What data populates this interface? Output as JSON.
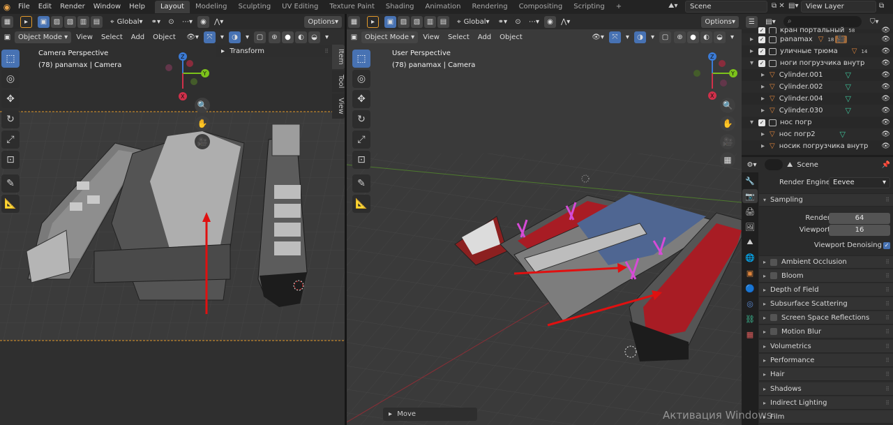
{
  "menu": [
    "File",
    "Edit",
    "Render",
    "Window",
    "Help"
  ],
  "workspaces": [
    "Layout",
    "Modeling",
    "Sculpting",
    "UV Editing",
    "Texture Paint",
    "Shading",
    "Animation",
    "Rendering",
    "Compositing",
    "Scripting"
  ],
  "active_workspace": "Layout",
  "add_workspace": "+",
  "scene": "Scene",
  "view_layer": "View Layer",
  "viewport_header": {
    "mode": "Object Mode",
    "menus": [
      "View",
      "Select",
      "Add",
      "Object"
    ],
    "orientation": "Global",
    "options": "Options"
  },
  "left_viewport": {
    "title": "Camera Perspective",
    "subtitle": "(78) panamax | Camera",
    "panel": "Transform",
    "side_tabs": [
      "Item",
      "Tool",
      "View"
    ]
  },
  "right_viewport": {
    "title": "User Perspective",
    "subtitle": "(78) panamax | Camera",
    "operator_panel": "Move"
  },
  "outliner": {
    "rows": [
      {
        "label": "кран портальный",
        "kind": "collection",
        "badge": "58"
      },
      {
        "label": "panamax",
        "kind": "collection",
        "badge": "18"
      },
      {
        "label": "уличные трюма",
        "kind": "collection",
        "badge": "14"
      },
      {
        "label": "ноги погрузчика внутр",
        "kind": "collection",
        "badge": ""
      },
      {
        "label": "Cylinder.001",
        "kind": "object",
        "badge": ""
      },
      {
        "label": "Cylinder.002",
        "kind": "object",
        "badge": ""
      },
      {
        "label": "Cylinder.004",
        "kind": "object",
        "badge": ""
      },
      {
        "label": "Cylinder.030",
        "kind": "object",
        "badge": ""
      },
      {
        "label": "нос погр",
        "kind": "collection",
        "badge": ""
      },
      {
        "label": "нос погр2",
        "kind": "object",
        "badge": ""
      },
      {
        "label": "носик погрузчика внутр",
        "kind": "object",
        "badge": ""
      }
    ]
  },
  "properties": {
    "context": "Scene",
    "render_engine_label": "Render Engine",
    "render_engine": "Eevee",
    "sampling": {
      "title": "Sampling",
      "render_label": "Render",
      "render": "64",
      "viewport_label": "Viewport",
      "viewport": "16",
      "denoise_label": "Viewport Denoising"
    },
    "panels": [
      {
        "label": "Ambient Occlusion",
        "checkbox": true
      },
      {
        "label": "Bloom",
        "checkbox": true
      },
      {
        "label": "Depth of Field",
        "checkbox": false
      },
      {
        "label": "Subsurface Scattering",
        "checkbox": false
      },
      {
        "label": "Screen Space Reflections",
        "checkbox": true
      },
      {
        "label": "Motion Blur",
        "checkbox": true
      },
      {
        "label": "Volumetrics",
        "checkbox": false
      },
      {
        "label": "Performance",
        "checkbox": false
      },
      {
        "label": "Hair",
        "checkbox": false
      },
      {
        "label": "Shadows",
        "checkbox": false
      },
      {
        "label": "Indirect Lighting",
        "checkbox": false
      },
      {
        "label": "Film",
        "checkbox": false
      }
    ]
  },
  "watermark": "Активация Windows",
  "colors": {
    "accent": "#4772b3",
    "annotation_arrow": "#e01010",
    "hull_red": "#a81c24",
    "crane_magenta": "#d64bd6"
  }
}
